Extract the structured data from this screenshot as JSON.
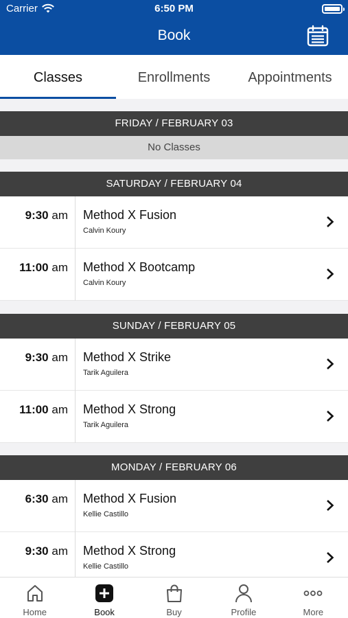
{
  "status": {
    "carrier": "Carrier",
    "time": "6:50 PM"
  },
  "nav": {
    "title": "Book",
    "calendar_icon": "calendar-icon"
  },
  "tabs": [
    {
      "label": "Classes",
      "active": true
    },
    {
      "label": "Enrollments",
      "active": false
    },
    {
      "label": "Appointments",
      "active": false
    }
  ],
  "days": [
    {
      "header": "FRIDAY / FEBRUARY 03",
      "empty_text": "No Classes"
    },
    {
      "header": "SATURDAY / FEBRUARY 04",
      "classes": [
        {
          "time": "9:30",
          "ampm": "am",
          "name": "Method X Fusion",
          "instructor": "Calvin Koury"
        },
        {
          "time": "11:00",
          "ampm": "am",
          "name": "Method X Bootcamp",
          "instructor": "Calvin Koury"
        }
      ]
    },
    {
      "header": "SUNDAY / FEBRUARY 05",
      "classes": [
        {
          "time": "9:30",
          "ampm": "am",
          "name": "Method X Strike",
          "instructor": "Tarik Aguilera"
        },
        {
          "time": "11:00",
          "ampm": "am",
          "name": "Method X Strong",
          "instructor": "Tarik Aguilera"
        }
      ]
    },
    {
      "header": "MONDAY / FEBRUARY 06",
      "classes": [
        {
          "time": "6:30",
          "ampm": "am",
          "name": "Method X Fusion",
          "instructor": "Kellie Castillo"
        },
        {
          "time": "9:30",
          "ampm": "am",
          "name": "Method X Strong",
          "instructor": "Kellie Castillo"
        }
      ]
    }
  ],
  "tabbar": [
    {
      "label": "Home",
      "icon": "home-icon"
    },
    {
      "label": "Book",
      "icon": "book-plus-icon",
      "active": true
    },
    {
      "label": "Buy",
      "icon": "shopping-bag-icon"
    },
    {
      "label": "Profile",
      "icon": "profile-icon"
    },
    {
      "label": "More",
      "icon": "more-dots-icon"
    }
  ],
  "colors": {
    "brand": "#0b4ea2",
    "day_header": "#3f3f3f",
    "no_classes_bg": "#d8d8d8"
  }
}
